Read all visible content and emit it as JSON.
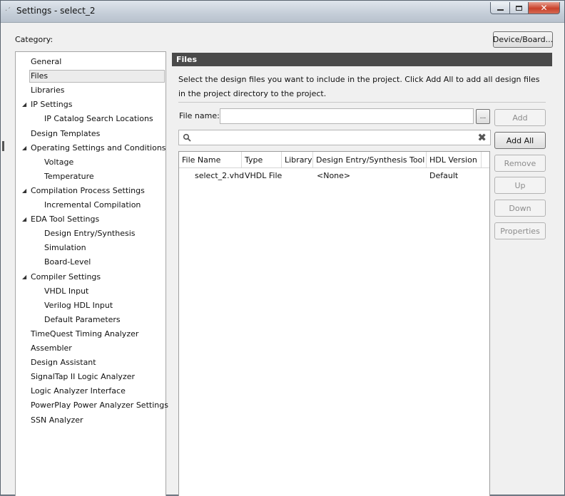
{
  "window": {
    "title": "Settings - select_2",
    "controls": {
      "close": "✕"
    }
  },
  "category_label": "Category:",
  "device_board_button": "Device/Board...",
  "tree": [
    {
      "label": "General",
      "level": 0
    },
    {
      "label": "Files",
      "level": 0,
      "selected": true
    },
    {
      "label": "Libraries",
      "level": 0
    },
    {
      "label": "IP Settings",
      "level": 0,
      "expanded": true
    },
    {
      "label": "IP Catalog Search Locations",
      "level": 1
    },
    {
      "label": "Design Templates",
      "level": 0
    },
    {
      "label": "Operating Settings and Conditions",
      "level": 0,
      "expanded": true
    },
    {
      "label": "Voltage",
      "level": 1
    },
    {
      "label": "Temperature",
      "level": 1
    },
    {
      "label": "Compilation Process Settings",
      "level": 0,
      "expanded": true
    },
    {
      "label": "Incremental Compilation",
      "level": 1
    },
    {
      "label": "EDA Tool Settings",
      "level": 0,
      "expanded": true
    },
    {
      "label": "Design Entry/Synthesis",
      "level": 1
    },
    {
      "label": "Simulation",
      "level": 1
    },
    {
      "label": "Board-Level",
      "level": 1
    },
    {
      "label": "Compiler Settings",
      "level": 0,
      "expanded": true
    },
    {
      "label": "VHDL Input",
      "level": 1
    },
    {
      "label": "Verilog HDL Input",
      "level": 1
    },
    {
      "label": "Default Parameters",
      "level": 1
    },
    {
      "label": "TimeQuest Timing Analyzer",
      "level": 0
    },
    {
      "label": "Assembler",
      "level": 0
    },
    {
      "label": "Design Assistant",
      "level": 0
    },
    {
      "label": "SignalTap II Logic Analyzer",
      "level": 0
    },
    {
      "label": "Logic Analyzer Interface",
      "level": 0
    },
    {
      "label": "PowerPlay Power Analyzer Settings",
      "level": 0
    },
    {
      "label": "SSN Analyzer",
      "level": 0
    }
  ],
  "files_panel": {
    "header": "Files",
    "description": "Select the design files you want to include in the project. Click Add All to add all design files in the project directory to the project.",
    "file_name_label": "File name:",
    "file_name_value": "",
    "browse_label": "...",
    "search_value": "",
    "clear_glyph": "✖",
    "buttons": {
      "add": "Add",
      "add_all": "Add All",
      "remove": "Remove",
      "up": "Up",
      "down": "Down",
      "properties": "Properties"
    },
    "table": {
      "columns": [
        "File Name",
        "Type",
        "Library",
        "Design Entry/Synthesis Tool",
        "HDL Version"
      ],
      "rows": [
        [
          "select_2.vhd",
          "VHDL File",
          "",
          "<None>",
          "Default"
        ]
      ]
    }
  }
}
